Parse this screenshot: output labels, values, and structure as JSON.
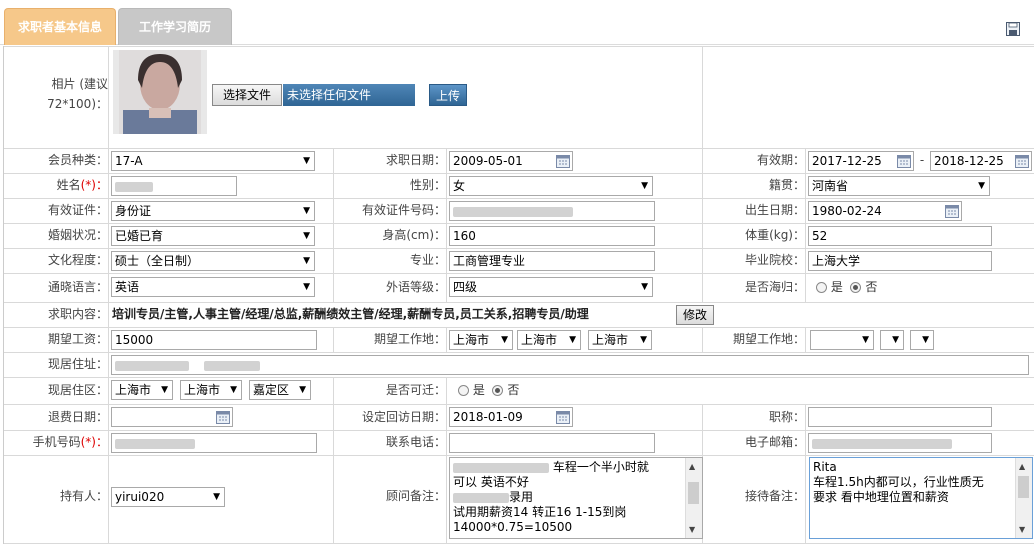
{
  "tabs": [
    {
      "label": "求职者基本信息"
    },
    {
      "label": "工作学习简历"
    }
  ],
  "photo": {
    "label": "相片 (建议",
    "label2": "72*100)：",
    "choose_label": "选择文件",
    "no_file": "未选择任何文件",
    "upload_label": "上传"
  },
  "labels": {
    "member_type": "会员种类：",
    "job_date": "求职日期：",
    "valid_period": "有效期：",
    "name": "姓名",
    "gender": "性别：",
    "native": "籍贯：",
    "id_type": "有效证件：",
    "id_no": "有效证件号码：",
    "birth": "出生日期：",
    "marital": "婚姻状况：",
    "height": "身高(cm)：",
    "weight": "体重(kg)：",
    "education": "文化程度：",
    "major": "专业：",
    "school": "毕业院校：",
    "language": "通晓语言：",
    "lang_level": "外语等级：",
    "returnee": "是否海归：",
    "intent": "求职内容：",
    "salary": "期望工资：",
    "work_place": "期望工作地：",
    "work_place2": "期望工作地：",
    "address": "现居住址：",
    "district": "现居住区：",
    "relocate": "是否可迁：",
    "refund_date": "退费日期：",
    "visit_date": "设定回访日期：",
    "title": "职称：",
    "mobile": "手机号码",
    "phone": "联系电话：",
    "email": "电子邮箱：",
    "owner": "持有人：",
    "advisor_note": "顾问备注：",
    "reception_note": "接待备注：",
    "required_mark": "(*)："
  },
  "values": {
    "member_type": "17-A",
    "job_date": "2009-05-01",
    "valid_from": "2017-12-25",
    "valid_sep": "-",
    "valid_to": "2018-12-25",
    "gender": "女",
    "native": "河南省",
    "id_type": "身份证",
    "birth": "1980-02-24",
    "marital": "已婚已育",
    "height": "160",
    "weight": "52",
    "education": "硕士（全日制）",
    "major": "工商管理专业",
    "school": "上海大学",
    "language": "英语",
    "lang_level": "四级",
    "returnee_yes": "是",
    "returnee_no": "否",
    "intent": "培训专员/主管,人事主管/经理/总监,薪酬绩效主管/经理,薪酬专员,员工关系,招聘专员/助理",
    "modify_label": "修改",
    "salary": "15000",
    "place1": "上海市",
    "place2": "上海市",
    "place3": "上海市",
    "district1": "上海市",
    "district2": "上海市",
    "district3": "嘉定区",
    "relocate_yes": "是",
    "relocate_no": "否",
    "visit_date": "2018-01-09",
    "owner": "yirui020",
    "advisor_lines": [
      "车程一个半小时就",
      "可以  英语不好",
      "录用",
      "试用期薪资14  转正16  1-15到岗",
      "14000*0.75=10500"
    ],
    "reception_lines": [
      "Rita",
      "车程1.5h内都可以，行业性质无",
      "要求  看中地理位置和薪资"
    ]
  }
}
